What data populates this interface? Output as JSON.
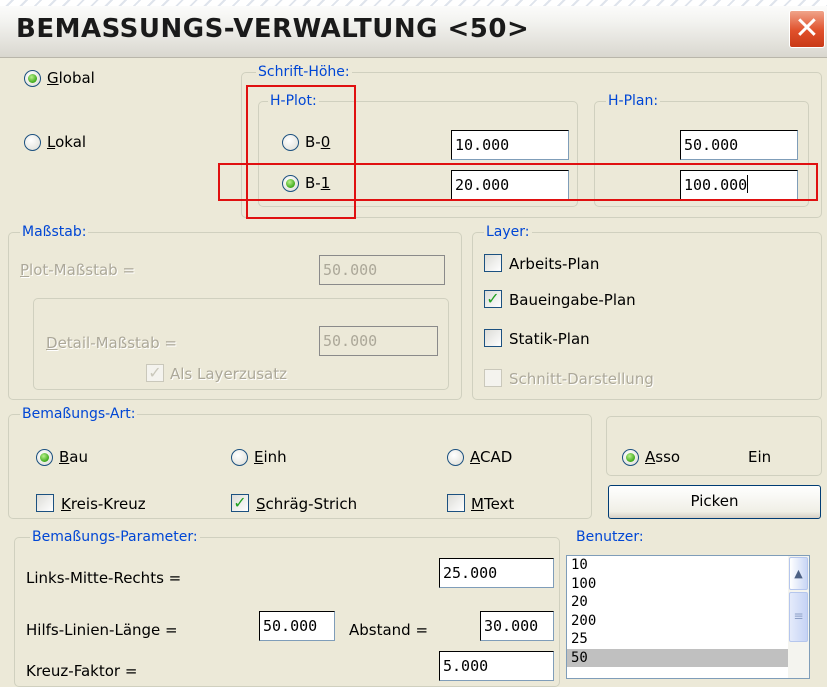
{
  "window": {
    "title": "BEMASSUNGS-VERWALTUNG <50>",
    "close_label": "✕"
  },
  "scope": {
    "global_label": "Global",
    "global_mnemonic": "G",
    "global_rest": "lobal",
    "lokal_mnemonic": "L",
    "lokal_rest": "okal",
    "selected": "global"
  },
  "schrift_hoehe": {
    "label": "Schrift-Höhe:",
    "h_plot_label": "H-Plot:",
    "h_plan_label": "H-Plan:",
    "b0_prefix": "B-",
    "b0_mnemonic": "0",
    "b1_prefix": "B-",
    "b1_mnemonic": "1",
    "b0_plot_value": "10.000",
    "b1_plot_value": "20.000",
    "b0_plan_value": "50.000",
    "b1_plan_value": "100.000",
    "selected": "B-1"
  },
  "massstab": {
    "label": "Maßstab:",
    "plot_mnemonic": "P",
    "plot_rest": "lot-Maßstab =",
    "plot_value": "50.000",
    "detail_mnemonic": "D",
    "detail_rest": "etail-Maßstab =",
    "detail_value": "50.000",
    "als_layerzusatz_label": "Als Layerzusatz",
    "als_layerzusatz_checked": true
  },
  "layer": {
    "label": "Layer:",
    "items": [
      {
        "label": "Arbeits-Plan",
        "checked": false,
        "disabled": false
      },
      {
        "label": "Baueingabe-Plan",
        "checked": true,
        "disabled": false
      },
      {
        "label": "Statik-Plan",
        "checked": false,
        "disabled": false
      },
      {
        "label": "Schnitt-Darstellung",
        "checked": false,
        "disabled": true
      }
    ]
  },
  "bemassungs_art": {
    "label": "Bemaßungs-Art:",
    "bau_mnemonic": "B",
    "bau_rest": "au",
    "einh_mnemonic": "E",
    "einh_rest": "inh",
    "acad_mnemonic": "A",
    "acad_rest": "CAD",
    "selected": "Bau",
    "kreis_mnemonic": "K",
    "kreis_rest": "reis-Kreuz",
    "kreis_checked": false,
    "schraeg_mnemonic": "S",
    "schraeg_rest": "chräg-Strich",
    "schraeg_checked": true,
    "mtext_mnemonic": "M",
    "mtext_rest": "Text",
    "mtext_checked": false
  },
  "asso": {
    "mnemonic": "A",
    "rest": "sso",
    "checked": true,
    "status": "Ein",
    "picken_label": "Picken"
  },
  "parameter": {
    "label": "Bemaßungs-Parameter:",
    "links_mitte_label": "Links-Mitte-Rechts =",
    "links_mitte_value": "25.000",
    "hilfs_label": "Hilfs-Linien-Länge =",
    "hilfs_value": "50.000",
    "abstand_label": "Abstand =",
    "abstand_value": "30.000",
    "kreuz_label": "Kreuz-Faktor =",
    "kreuz_value": "5.000"
  },
  "benutzer": {
    "label": "Benutzer:",
    "items": [
      "10",
      "100",
      "20",
      "200",
      "25",
      "50"
    ],
    "selected": "50"
  },
  "colors": {
    "group_label": "#0046d5",
    "annotation_red": "#e01010",
    "dialog_bg": "#ece9d8"
  },
  "icons": {
    "close": "close-x-icon",
    "scroll_up": "chevron-up-icon",
    "scroll_thumb": "grip-icon"
  }
}
